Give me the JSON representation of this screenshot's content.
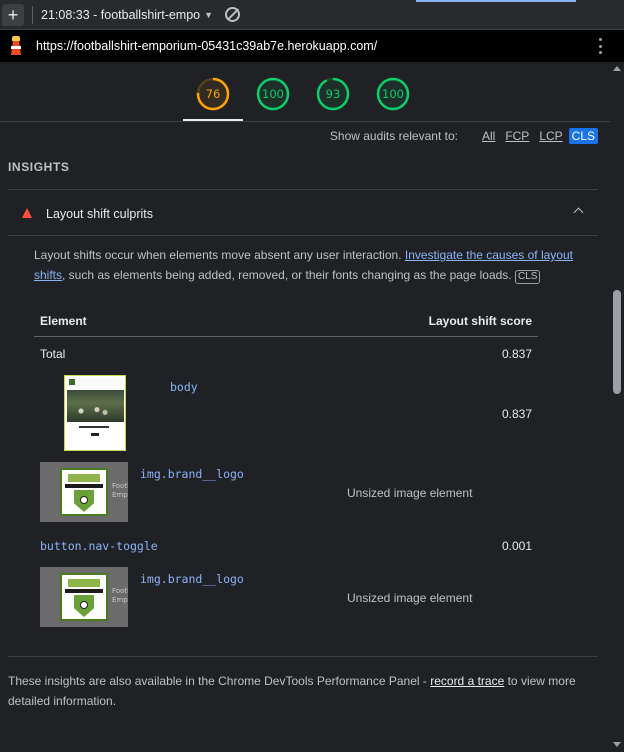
{
  "topbar": {
    "new_tab": "+",
    "report_label": "21:08:33 - footballshirt-empo",
    "caret": "▼"
  },
  "urlbar": {
    "url": "https://footballshirt-emporium-05431c39ab7e.herokuapp.com/"
  },
  "gauges": [
    {
      "score": "76",
      "value": 76,
      "color": "#ffa400"
    },
    {
      "score": "100",
      "value": 100,
      "color": "#0cce6b"
    },
    {
      "score": "93",
      "value": 93,
      "color": "#0cce6b"
    },
    {
      "score": "100",
      "value": 100,
      "color": "#0cce6b"
    }
  ],
  "filter": {
    "label": "Show audits relevant to:",
    "options": [
      "All",
      "FCP",
      "LCP",
      "CLS"
    ],
    "active": "CLS"
  },
  "insights": {
    "section_title": "INSIGHTS",
    "audit_title": "Layout shift culprits",
    "desc_before": "Layout shifts occur when elements move absent any user interaction. ",
    "desc_link": "Investigate the causes of layout shifts",
    "desc_after": ", such as elements being added, removed, or their fonts changing as the page loads. ",
    "desc_tag": "CLS"
  },
  "table": {
    "col_element": "Element",
    "col_score": "Layout shift score",
    "total_label": "Total",
    "total_value": "0.837",
    "rows": [
      {
        "selector": "body",
        "score": "0.837"
      },
      {
        "selector": "img.brand__logo",
        "note": "Unsized image element"
      },
      {
        "selector": "button.nav-toggle",
        "score": "0.001"
      },
      {
        "selector": "img.brand__logo",
        "note": "Unsized image element"
      }
    ],
    "thumb_caption": "Footb\nEmpo"
  },
  "footer": {
    "before": "These insights are also available in the Chrome DevTools Performance Panel - ",
    "link": "record a trace",
    "after": " to view more detailed information."
  }
}
